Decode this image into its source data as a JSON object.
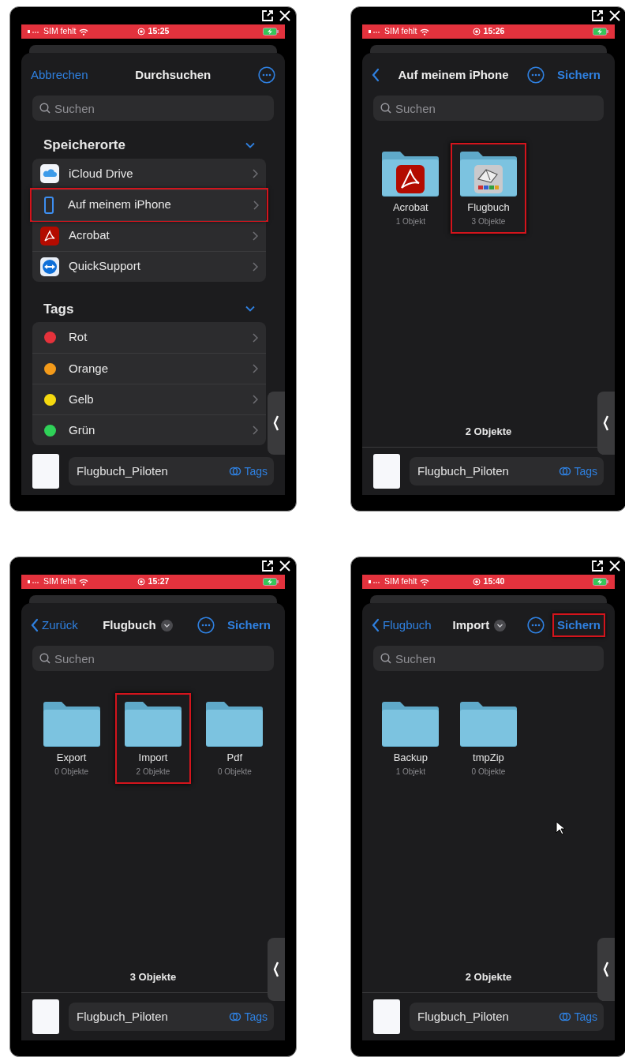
{
  "panels": [
    {
      "kind": "browse",
      "status": {
        "carrier": "SIM fehlt",
        "time": "15:25"
      },
      "nav": {
        "leading": {
          "kind": "cancel",
          "label": "Abbrechen"
        },
        "title": "Durchsuchen"
      },
      "search": {
        "placeholder": "Suchen"
      },
      "sections": [
        {
          "title": "Speicherorte",
          "expanded": true,
          "items": [
            {
              "kind": "icloud",
              "label": "iCloud Drive",
              "highlighted": false
            },
            {
              "kind": "phone",
              "label": "Auf meinem iPhone",
              "highlighted": true
            },
            {
              "kind": "acrobat",
              "label": "Acrobat",
              "highlighted": false
            },
            {
              "kind": "support",
              "label": "QuickSupport",
              "highlighted": false
            }
          ]
        },
        {
          "title": "Tags",
          "expanded": true,
          "items": [
            {
              "kind": "tag",
              "label": "Rot",
              "color": "#e5323b",
              "highlighted": false
            },
            {
              "kind": "tag",
              "label": "Orange",
              "color": "#f39a1a",
              "highlighted": false
            },
            {
              "kind": "tag",
              "label": "Gelb",
              "color": "#f5d90f",
              "highlighted": false
            },
            {
              "kind": "tag",
              "label": "Grün",
              "color": "#2fd158",
              "highlighted": false
            }
          ]
        }
      ],
      "file": {
        "name": "Flugbuch_Piloten",
        "tags": "Tags"
      }
    },
    {
      "kind": "grid",
      "status": {
        "carrier": "SIM fehlt",
        "time": "15:26"
      },
      "nav": {
        "leading": {
          "kind": "back"
        },
        "title": "Auf meinem iPhone",
        "action": "Sichern"
      },
      "search": {
        "placeholder": "Suchen"
      },
      "folders": [
        {
          "kind": "acrobat",
          "name": "Acrobat",
          "count": "1 Objekt",
          "highlighted": false
        },
        {
          "kind": "logbook",
          "name": "Flugbuch",
          "count": "3 Objekte",
          "highlighted": true
        }
      ],
      "count": "2 Objekte",
      "file": {
        "name": "Flugbuch_Piloten",
        "tags": "Tags"
      }
    },
    {
      "kind": "grid",
      "status": {
        "carrier": "SIM fehlt",
        "time": "15:27"
      },
      "nav": {
        "leading": {
          "kind": "back",
          "label": "Zurück"
        },
        "title": "Flugbuch",
        "title_menu": true,
        "action": "Sichern"
      },
      "search": {
        "placeholder": "Suchen"
      },
      "folders": [
        {
          "kind": "plain",
          "name": "Export",
          "count": "0 Objekte",
          "highlighted": false
        },
        {
          "kind": "plain",
          "name": "Import",
          "count": "2 Objekte",
          "highlighted": true
        },
        {
          "kind": "plain",
          "name": "Pdf",
          "count": "0 Objekte",
          "highlighted": false
        }
      ],
      "count": "3 Objekte",
      "file": {
        "name": "Flugbuch_Piloten",
        "tags": "Tags"
      }
    },
    {
      "kind": "grid",
      "pointer": true,
      "status": {
        "carrier": "SIM fehlt",
        "time": "15:40"
      },
      "nav": {
        "leading": {
          "kind": "back",
          "label": "Flugbuch"
        },
        "title": "Import",
        "title_menu": true,
        "action": "Sichern",
        "action_highlighted": true
      },
      "search": {
        "placeholder": "Suchen"
      },
      "folders": [
        {
          "kind": "plain",
          "name": "Backup",
          "count": "1 Objekt",
          "highlighted": false
        },
        {
          "kind": "plain",
          "name": "tmpZip",
          "count": "0 Objekte",
          "highlighted": false
        }
      ],
      "count": "2 Objekte",
      "file": {
        "name": "Flugbuch_Piloten",
        "tags": "Tags"
      }
    }
  ]
}
